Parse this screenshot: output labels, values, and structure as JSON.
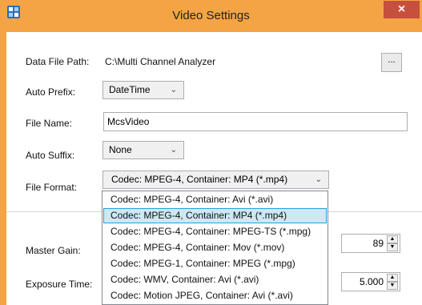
{
  "window": {
    "title": "Video Settings",
    "close_glyph": "×"
  },
  "form": {
    "data_file_path_label": "Data File Path:",
    "data_file_path_value": "C:\\Multi Channel Analyzer",
    "browse_label": "...",
    "auto_prefix_label": "Auto Prefix:",
    "auto_prefix_value": "DateTime",
    "file_name_label": "File Name:",
    "file_name_value": "McsVideo",
    "auto_suffix_label": "Auto Suffix:",
    "auto_suffix_value": "None",
    "file_format_label": "File Format:",
    "file_format_value": "Codec: MPEG-4, Container: MP4 (*.mp4)",
    "master_gain_label": "Master Gain:",
    "master_gain_value": "89",
    "exposure_time_label": "Exposure Time:",
    "exposure_time_value": "5.000"
  },
  "file_format_options": [
    "Codec: MPEG-4, Container: Avi (*.avi)",
    "Codec: MPEG-4, Container: MP4 (*.mp4)",
    "Codec: MPEG-4, Container: MPEG-TS (*.mpg)",
    "Codec: MPEG-4, Container: Mov (*.mov)",
    "Codec: MPEG-1, Container: MPEG (*.mpg)",
    "Codec: WMV, Container: Avi (*.avi)",
    "Codec: Motion JPEG, Container: Avi (*.avi)"
  ],
  "selected_option_index": 1,
  "icons": {
    "chevron": "chevron-down-icon",
    "app": "app-icon",
    "spin_up": "spin-up-icon",
    "spin_down": "spin-down-icon"
  },
  "colors": {
    "titlebar": "#f4a444",
    "close_button": "#c7503c",
    "selection_background": "#cde8f7",
    "selection_border": "#26a0da"
  }
}
